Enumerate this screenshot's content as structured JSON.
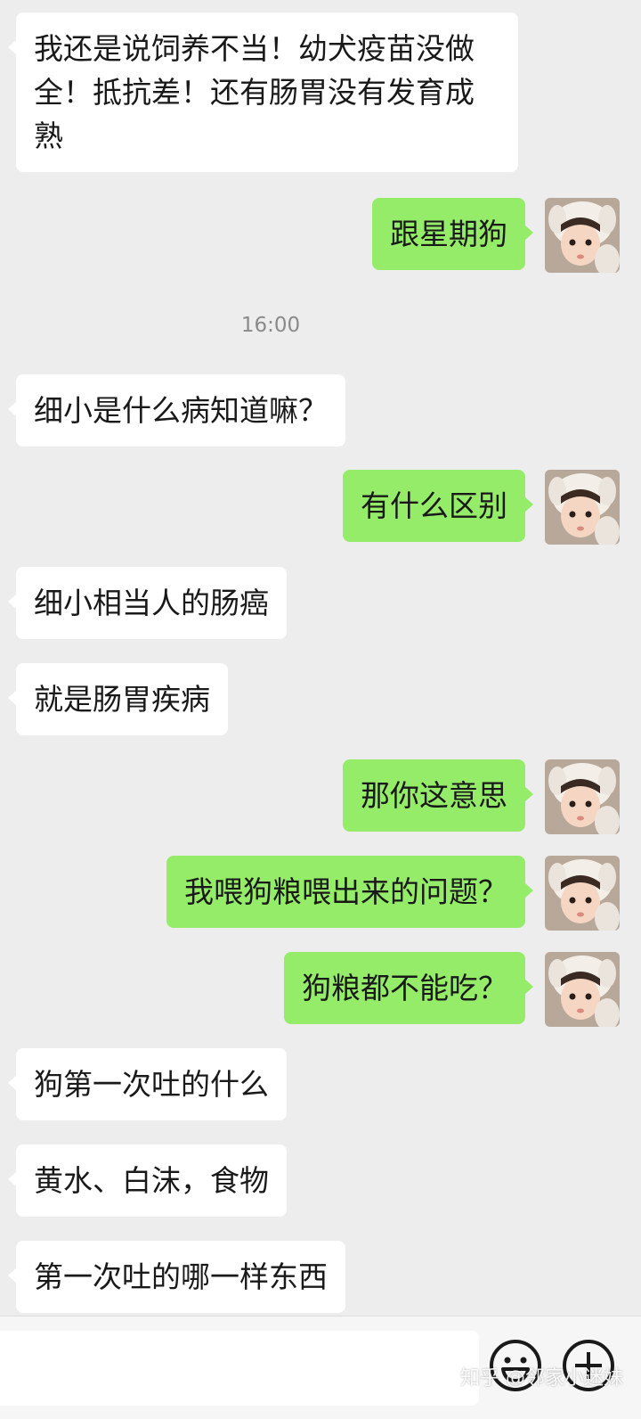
{
  "messages": [
    {
      "side": "in",
      "text": "我还是说饲养不当！幼犬疫苗没做全！抵抗差！还有肠胃没有发育成熟"
    },
    {
      "side": "out",
      "text": "跟星期狗"
    },
    {
      "side": "in",
      "text": "细小是什么病知道嘛？"
    },
    {
      "side": "out",
      "text": "有什么区别"
    },
    {
      "side": "in",
      "text": "细小相当人的肠癌"
    },
    {
      "side": "in",
      "text": "就是肠胃疾病"
    },
    {
      "side": "out",
      "text": "那你这意思"
    },
    {
      "side": "out",
      "text": "我喂狗粮喂出来的问题？"
    },
    {
      "side": "out",
      "text": "狗粮都不能吃？"
    },
    {
      "side": "in",
      "text": "狗第一次吐的什么"
    },
    {
      "side": "in",
      "text": "黄水、白沫，食物"
    },
    {
      "side": "in",
      "text": "第一次吐的哪一样东西"
    }
  ],
  "timestamp": "16:00",
  "input": {
    "placeholder": ""
  },
  "icons": {
    "emoji": "smiley-icon",
    "more": "plus-icon"
  },
  "watermark": "知乎 @邻家小迷妹",
  "colors": {
    "out_bubble": "#95ec69",
    "in_bubble": "#ffffff",
    "background": "#ededed"
  }
}
